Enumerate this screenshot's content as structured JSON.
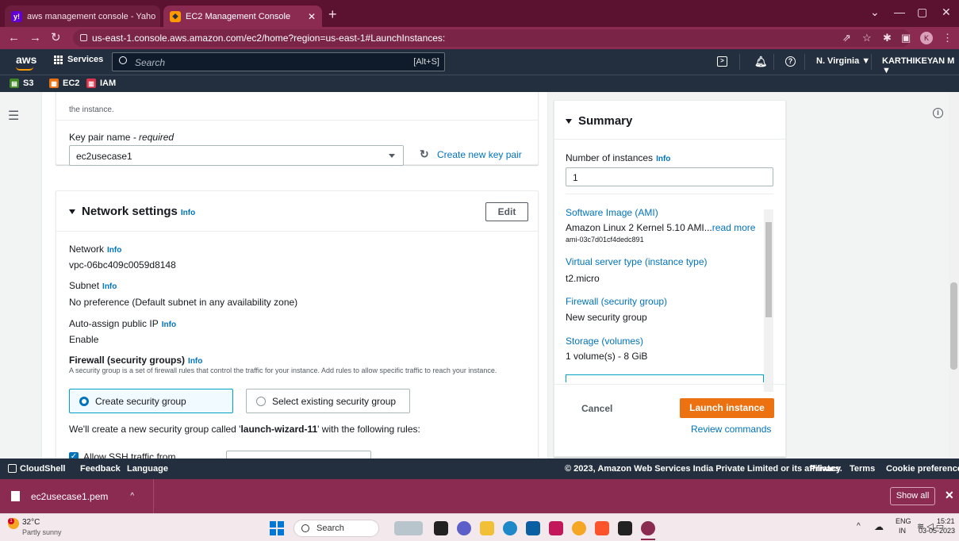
{
  "browser": {
    "tabs": [
      {
        "title": "aws management console - Yaho",
        "favicon": "yahoo-icon"
      },
      {
        "title": "EC2 Management Console",
        "favicon": "aws-icon"
      }
    ],
    "url": "us-east-1.console.aws.amazon.com/ec2/home?region=us-east-1#LaunchInstances:"
  },
  "aws_header": {
    "logo": "aws",
    "services_label": "Services",
    "search_placeholder": "Search",
    "search_shortcut": "[Alt+S]",
    "region": "N. Virginia ▼",
    "user": "KARTHIKEYAN M ▼"
  },
  "favorites": [
    "S3",
    "EC2",
    "IAM"
  ],
  "colors": {
    "accent": "#0073bb",
    "orange": "#ec7211",
    "header": "#232f3e",
    "browser": "#8b2b52"
  },
  "keypair": {
    "truncated_text": "the instance.",
    "label": "Key pair name",
    "required": "- required",
    "value": "ec2usecase1",
    "create_link": "Create new key pair"
  },
  "network": {
    "title": "Network settings",
    "info": "Info",
    "edit": "Edit",
    "network_label": "Network",
    "network_value": "vpc-06bc409c0059d8148",
    "subnet_label": "Subnet",
    "subnet_value": "No preference (Default subnet in any availability zone)",
    "public_ip_label": "Auto-assign public IP",
    "public_ip_value": "Enable",
    "firewall_label": "Firewall (security groups)",
    "firewall_desc": "A security group is a set of firewall rules that control the traffic for your instance. Add rules to allow specific traffic to reach your instance.",
    "option_create": "Create security group",
    "option_existing": "Select existing security group",
    "sg_note_prefix": "We'll create a new security group called '",
    "sg_name": "launch-wizard-11",
    "sg_note_suffix": "' with the following rules:",
    "ssh_label": "Allow SSH traffic from"
  },
  "summary": {
    "title": "Summary",
    "instances_label": "Number of instances",
    "info": "Info",
    "instances_value": "1",
    "ami_label": "Software Image (AMI)",
    "ami_value": "Amazon Linux 2 Kernel 5.10 AMI...",
    "ami_more": "read more",
    "ami_id": "ami-03c7d01cf4dedc891",
    "type_label": "Virtual server type (instance type)",
    "type_value": "t2.micro",
    "firewall_label": "Firewall (security group)",
    "firewall_value": "New security group",
    "storage_label": "Storage (volumes)",
    "storage_value": "1 volume(s) - 8 GiB",
    "cancel": "Cancel",
    "launch": "Launch instance",
    "review": "Review commands"
  },
  "aws_footer": {
    "cloudshell": "CloudShell",
    "feedback": "Feedback",
    "language": "Language",
    "copyright": "© 2023, Amazon Web Services India Private Limited or its affiliates.",
    "privacy": "Privacy",
    "terms": "Terms",
    "cookies": "Cookie preferences"
  },
  "download": {
    "file": "ec2usecase1.pem",
    "show_all": "Show all"
  },
  "taskbar": {
    "temp": "32°C",
    "weather": "Partly sunny",
    "search": "Search",
    "lang1": "ENG",
    "lang2": "IN",
    "time": "15:21",
    "date": "03-05-2023"
  }
}
